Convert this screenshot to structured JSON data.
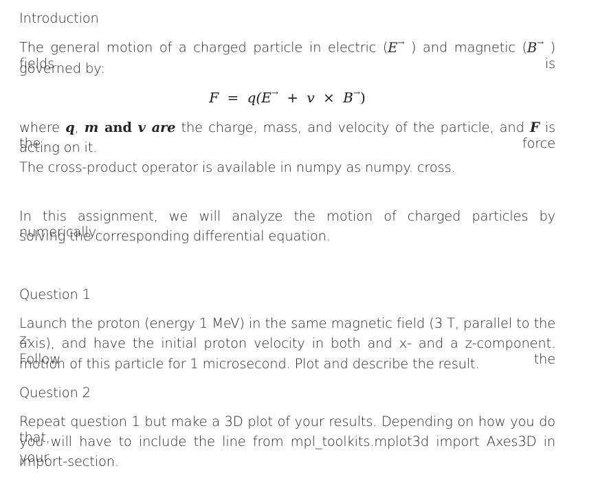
{
  "intro": {
    "heading": "Introduction",
    "p1_line1": {
      "pre": "The general motion of a charged particle in electric (",
      "E": "E",
      "arrow": "→",
      "mid": " ) and magnetic (",
      "B": "B",
      "post": " ) fields is"
    },
    "p1_line2": "governed by:",
    "equation": {
      "F": "F",
      "eq": "=",
      "q": "q(",
      "E": "E",
      "arrow": "→",
      "plus": "+",
      "v": "v",
      "times": "×",
      "B": "B",
      "close": ")"
    },
    "p2_line1": {
      "where": "where ",
      "q": "q",
      "comma": ", ",
      "m": "m",
      "and": " and ",
      "v": "v",
      "are": " are",
      "rest": " the charge, mass, and velocity of the particle, and ",
      "F": "F",
      "end": " is the force"
    },
    "p2_line2": "acting on it.",
    "p3": "The cross-product operator is available in numpy as numpy. cross.",
    "p4_line1": "In this assignment, we will analyze the motion of charged particles by numerically",
    "p4_line2": "solving the corresponding differential equation."
  },
  "q1": {
    "heading": "Question 1",
    "line1": "Launch the proton (energy 1 MeV) in the same magnetic field (3 T, parallel to the z-",
    "line2": "axis), and have the initial proton velocity in both and x- and a z-component. Follow the",
    "line3": "motion of this particle for 1 microsecond. Plot and describe the result."
  },
  "q2": {
    "heading": "Question 2",
    "line1": "Repeat question 1 but make a 3D plot of your results. Depending on how you do that,",
    "line2": "you will have to include the line from mpl_toolkits.mplot3d import Axes3D in your",
    "line3": "import-section."
  }
}
